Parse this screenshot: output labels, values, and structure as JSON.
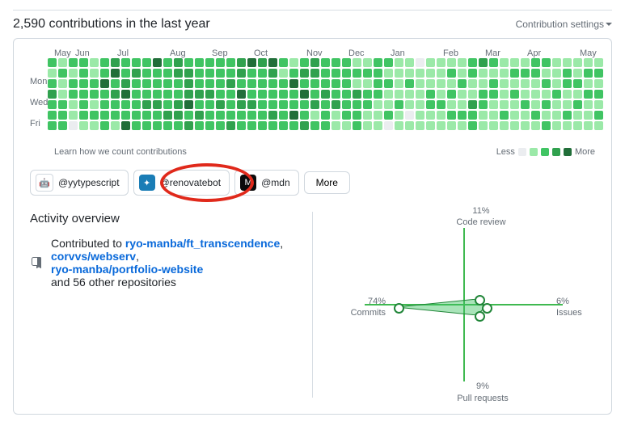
{
  "header": {
    "title": "2,590 contributions in the last year",
    "settings": "Contribution settings"
  },
  "months": [
    {
      "label": "May",
      "w": 2
    },
    {
      "label": "Jun",
      "w": 4
    },
    {
      "label": "Jul",
      "w": 5
    },
    {
      "label": "Aug",
      "w": 4
    },
    {
      "label": "Sep",
      "w": 4
    },
    {
      "label": "Oct",
      "w": 5
    },
    {
      "label": "Nov",
      "w": 4
    },
    {
      "label": "Dec",
      "w": 4
    },
    {
      "label": "Jan",
      "w": 5
    },
    {
      "label": "Feb",
      "w": 4
    },
    {
      "label": "Mar",
      "w": 4
    },
    {
      "label": "Apr",
      "w": 5
    },
    {
      "label": "May",
      "w": 3
    }
  ],
  "days": [
    "",
    "Mon",
    "",
    "Wed",
    "",
    "Fri",
    ""
  ],
  "footer": {
    "learn": "Learn how we count contributions",
    "less": "Less",
    "more": "More"
  },
  "orgs": [
    {
      "name": "@yytypescript",
      "bg": "#ffffff",
      "border": "#d0d7de",
      "emoji": "🤖"
    },
    {
      "name": "@renovatebot",
      "bg": "#1a7db6",
      "emoji": "✦"
    },
    {
      "name": "@mdn",
      "bg": "#0b0b0b",
      "emoji": "M"
    }
  ],
  "moreBtn": "More",
  "activity": {
    "heading": "Activity overview",
    "prefix": "Contributed to ",
    "repos": [
      "ryo-manba/ft_transcendence",
      "corvvs/webserv",
      "ryo-manba/portfolio-website"
    ],
    "suffix": "and 56 other repositories"
  },
  "radar": {
    "top": {
      "pct": "11%",
      "label": "Code review"
    },
    "right": {
      "pct": "6%",
      "label": "Issues"
    },
    "bottom": {
      "pct": "9%",
      "label": "Pull requests"
    },
    "left": {
      "pct": "74%",
      "label": "Commits"
    }
  },
  "gridLevels": [
    [
      2,
      1,
      2,
      2,
      1,
      2,
      3,
      2,
      2,
      2,
      4,
      2,
      3,
      2,
      2,
      2,
      2,
      2,
      3,
      4,
      3,
      4,
      2,
      1,
      2,
      3,
      2,
      2,
      2,
      1,
      1,
      2,
      2,
      1,
      1,
      0,
      1,
      1,
      1,
      1,
      2,
      3,
      2,
      1,
      1,
      1,
      2,
      2,
      1,
      1,
      1,
      1,
      1
    ],
    [
      1,
      2,
      1,
      2,
      1,
      2,
      4,
      2,
      3,
      2,
      2,
      2,
      3,
      3,
      2,
      2,
      2,
      2,
      3,
      2,
      2,
      3,
      1,
      2,
      3,
      3,
      2,
      2,
      2,
      2,
      2,
      2,
      1,
      1,
      1,
      1,
      1,
      1,
      2,
      1,
      2,
      1,
      1,
      1,
      2,
      2,
      2,
      1,
      1,
      2,
      1,
      2,
      2
    ],
    [
      2,
      1,
      2,
      2,
      2,
      4,
      2,
      3,
      2,
      2,
      2,
      2,
      2,
      3,
      2,
      2,
      2,
      3,
      2,
      2,
      2,
      2,
      2,
      4,
      2,
      2,
      2,
      2,
      2,
      1,
      1,
      2,
      2,
      1,
      2,
      1,
      1,
      1,
      1,
      2,
      1,
      1,
      2,
      1,
      1,
      1,
      1,
      2,
      1,
      2,
      2,
      1,
      1
    ],
    [
      3,
      1,
      2,
      2,
      2,
      2,
      3,
      4,
      2,
      2,
      2,
      2,
      2,
      3,
      3,
      3,
      2,
      2,
      4,
      2,
      2,
      2,
      2,
      2,
      4,
      2,
      3,
      2,
      2,
      3,
      2,
      2,
      1,
      1,
      1,
      1,
      2,
      1,
      2,
      1,
      1,
      2,
      2,
      1,
      2,
      1,
      1,
      1,
      2,
      1,
      1,
      2,
      2
    ],
    [
      2,
      2,
      1,
      2,
      1,
      2,
      2,
      2,
      2,
      3,
      3,
      2,
      3,
      4,
      2,
      2,
      3,
      2,
      3,
      3,
      2,
      2,
      2,
      2,
      2,
      3,
      2,
      3,
      2,
      2,
      2,
      1,
      1,
      2,
      1,
      1,
      2,
      2,
      1,
      1,
      3,
      2,
      1,
      1,
      1,
      2,
      1,
      2,
      1,
      1,
      2,
      1,
      1
    ],
    [
      2,
      2,
      1,
      2,
      2,
      2,
      2,
      2,
      2,
      2,
      2,
      3,
      3,
      2,
      3,
      2,
      2,
      2,
      2,
      2,
      2,
      3,
      2,
      4,
      2,
      1,
      2,
      1,
      2,
      2,
      1,
      1,
      2,
      1,
      0,
      1,
      1,
      1,
      2,
      2,
      2,
      1,
      1,
      2,
      1,
      1,
      2,
      1,
      1,
      2,
      1,
      1,
      2
    ],
    [
      2,
      2,
      0,
      1,
      1,
      2,
      1,
      4,
      2,
      2,
      2,
      2,
      2,
      3,
      2,
      2,
      2,
      3,
      2,
      2,
      2,
      2,
      2,
      2,
      3,
      2,
      2,
      1,
      1,
      2,
      1,
      1,
      0,
      1,
      1,
      1,
      1,
      1,
      1,
      1,
      2,
      1,
      1,
      1,
      1,
      1,
      1,
      2,
      1,
      1,
      1,
      1,
      1
    ]
  ]
}
